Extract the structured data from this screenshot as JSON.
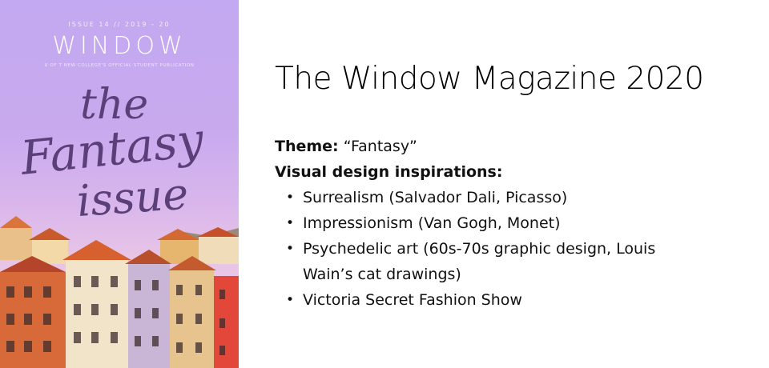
{
  "cover": {
    "issue_line": "ISSUE 14 // 2019 - 20",
    "masthead": "WINDOW",
    "tagline": "U OF T NEW COLLEGE'S OFFICIAL STUDENT PUBLICATION",
    "title_lines": [
      "the",
      "Fantasy",
      "issue"
    ],
    "colors": {
      "sky": "#c3a9f1",
      "title": "#5a3f78"
    }
  },
  "slide": {
    "title": "The Window Magazine 2020",
    "theme_label": "Theme:",
    "theme_value": " “Fantasy”",
    "inspirations_label": "Visual design inspirations:",
    "bullets": [
      "Surrealism (Salvador Dali, Picasso)",
      "Impressionism (Van Gogh, Monet)",
      "Psychedelic art (60s-70s graphic design, Louis",
      "Victoria Secret Fashion Show"
    ],
    "bullet_continuation": "Wain’s cat drawings)",
    "bullet_glyph": "•"
  }
}
